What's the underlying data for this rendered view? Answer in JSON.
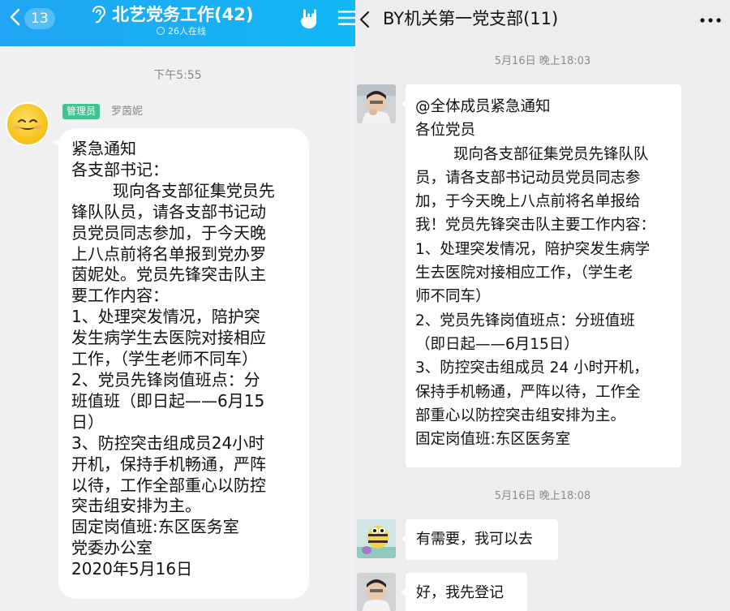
{
  "left_panel": {
    "header": {
      "unread_count": "13",
      "title": "北艺党务工作(42)",
      "online_status": "26人在线"
    },
    "timestamp": "下午5:55",
    "message": {
      "role_badge": "管理员",
      "sender_name": "罗茵妮",
      "text": "紧急通知\n各支部书记：\n        现向各支部征集党员先\n锋队队员，请各支部书记动\n员党员同志参加，于今天晚\n上八点前将名单报到党办罗\n茵妮处。党员先锋突击队主\n要工作内容：\n1、处理突发情况，陪护突\n发生病学生去医院对接相应\n工作，（学生老师不同车）\n2、党员先锋岗值班点：分\n班值班（即日起——6月15\n日）\n3、防控突击组成员24小时\n开机，保持手机畅通，严阵\n以待，工作全部重心以防控\n突击组安排为主。\n固定岗值班:东区医务室\n党委办公室\n2020年5月16日"
    }
  },
  "right_panel": {
    "header": {
      "title": "BY机关第一党支部(11)"
    },
    "timestamps": [
      "5月16日 晚上18:03",
      "5月16日 晚上18:08"
    ],
    "messages": [
      {
        "text": "@全体成员紧急通知\n各位党员\n        现向各支部征集党员先锋队队\n员，请各支部书记动员党员同志参\n加，于今天晚上八点前将名单报给\n我！党员先锋突击队主要工作内容：\n1、处理突发情况，陪护突发生病学\n生去医院对接相应工作，（学生老\n师不同车）\n2、党员先锋岗值班点：分班值班\n（即日起——6月15日）\n3、防控突击组成员 24 小时开机，\n保持手机畅通，严阵以待，工作全\n部重心以防控突击组安排为主。\n固定岗值班:东区医务室"
      },
      {
        "text": "有需要，我可以去"
      },
      {
        "text": "好，我先登记"
      }
    ]
  },
  "colors": {
    "qq_header": "#12b7f5",
    "admin_badge": "#45c08f",
    "wechat_bg": "#ededed",
    "qq_bg": "#f0f0f2"
  }
}
